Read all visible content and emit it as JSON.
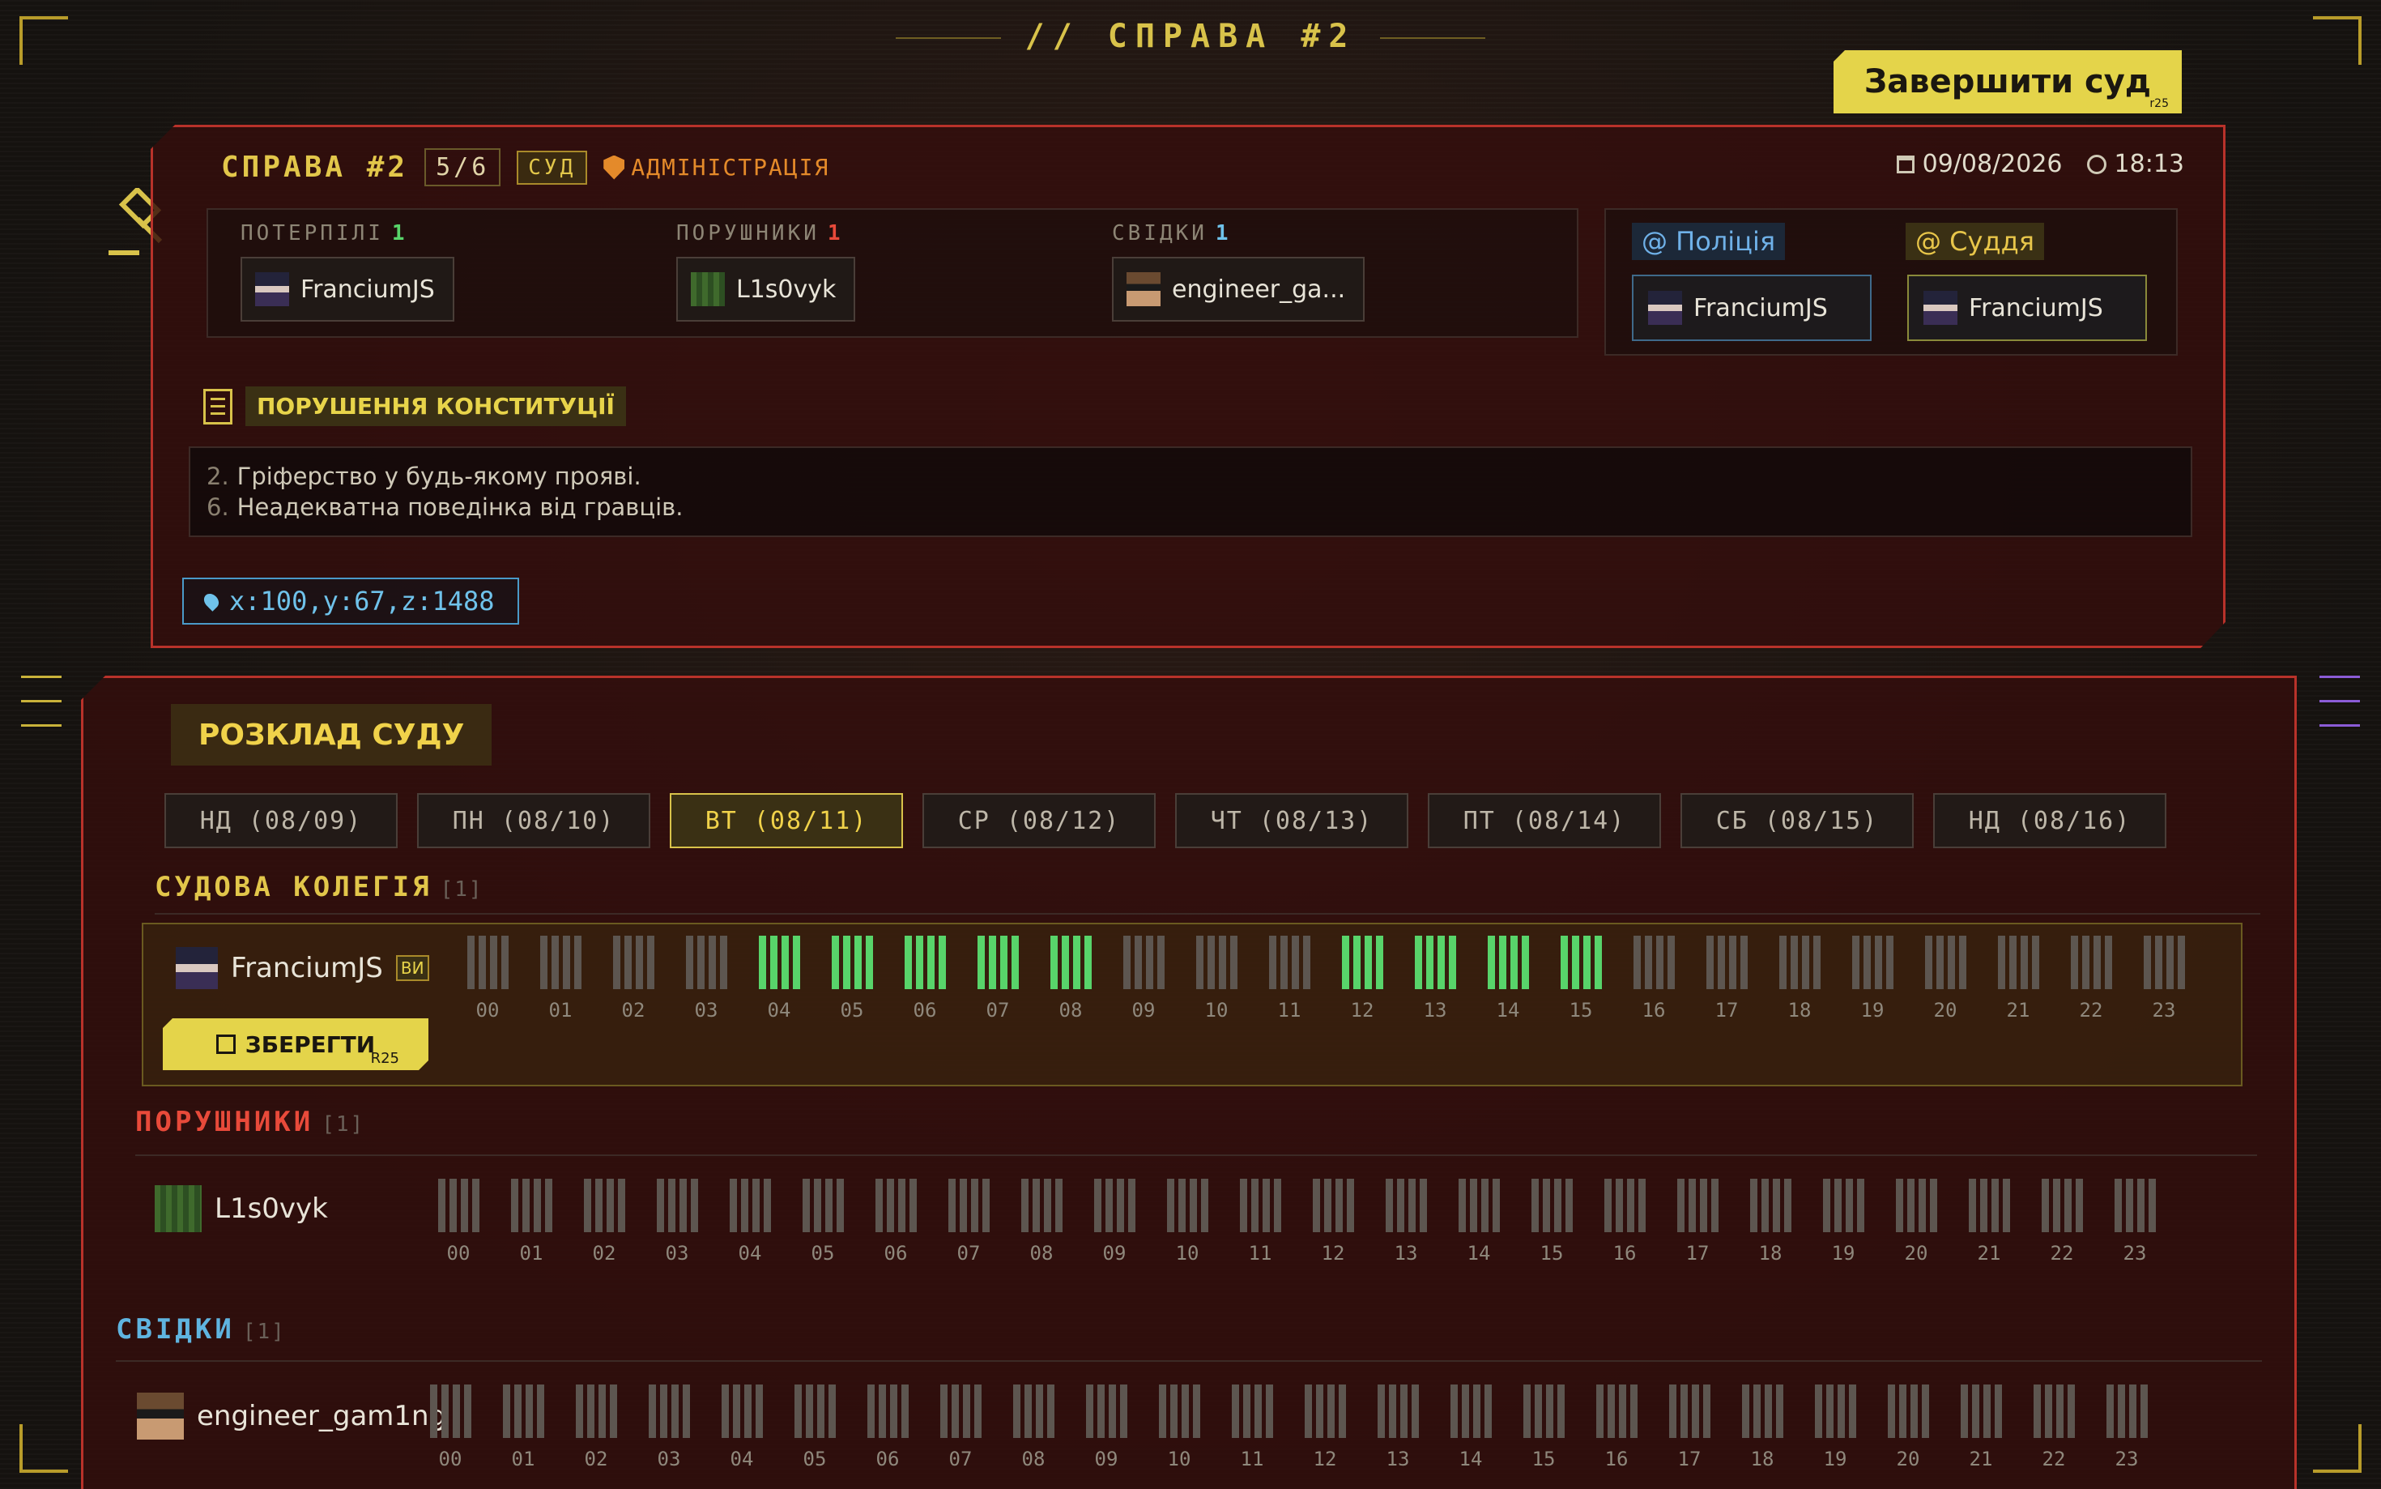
{
  "header": {
    "title": "// СПРАВА #2",
    "finish_button": "Завершити суд",
    "finish_hint": "r25"
  },
  "case": {
    "title": "СПРАВА #2",
    "progress": "5/6",
    "type": "СУД",
    "department": "АДМІНІСТРАЦІЯ",
    "date": "09/08/2026",
    "time": "18:13"
  },
  "parties": {
    "victims": {
      "label": "ПОТЕРПІЛІ",
      "count": "1",
      "players": [
        "FranciumJS"
      ]
    },
    "violators": {
      "label": "ПОРУШНИКИ",
      "count": "1",
      "players": [
        "L1s0vyk"
      ]
    },
    "witnesses": {
      "label": "СВІДКИ",
      "count": "1",
      "players": [
        "engineer_ga..."
      ]
    }
  },
  "roles": {
    "police": {
      "label": "@ Поліція",
      "player": "FranciumJS"
    },
    "judge": {
      "label": "@ Суддя",
      "player": "FranciumJS"
    }
  },
  "violation": {
    "label": "ПОРУШЕННЯ КОНСТИТУЦІЇ",
    "rules": [
      {
        "num": "2.",
        "text": "Гріферство у будь-якому прояві."
      },
      {
        "num": "6.",
        "text": "Неадекватна поведінка від гравців."
      }
    ]
  },
  "coords": "x:100,y:67,z:1488",
  "schedule": {
    "title": "РОЗКЛАД СУДУ",
    "days": [
      "НД (08/09)",
      "ПН (08/10)",
      "ВТ (08/11)",
      "СР (08/12)",
      "ЧТ (08/13)",
      "ПТ (08/14)",
      "СБ (08/15)",
      "НД (08/16)"
    ],
    "active_day": "ВТ (08/11)",
    "hours": [
      "00",
      "01",
      "02",
      "03",
      "04",
      "05",
      "06",
      "07",
      "08",
      "09",
      "10",
      "11",
      "12",
      "13",
      "14",
      "15",
      "16",
      "17",
      "18",
      "19",
      "20",
      "21",
      "22",
      "23"
    ],
    "judges": {
      "title": "СУДОВА КОЛЕГІЯ",
      "count": "[1]",
      "player": "FranciumJS",
      "you_tag": "ВИ",
      "save_label": "ЗБЕРЕГТИ",
      "save_hint": "R25",
      "available_hours": [
        4,
        5,
        6,
        7,
        8,
        12,
        13,
        14,
        15
      ]
    },
    "violators": {
      "title": "ПОРУШНИКИ",
      "count": "[1]",
      "player": "L1s0vyk",
      "available_hours": []
    },
    "witnesses": {
      "title": "СВІДКИ",
      "count": "[1]",
      "player": "engineer_gam1ng",
      "available_hours": []
    }
  },
  "colors": {
    "accent": "#e4d44a",
    "danger": "#b8322a",
    "available": "#58d46a",
    "witness": "#6fc2ea"
  }
}
